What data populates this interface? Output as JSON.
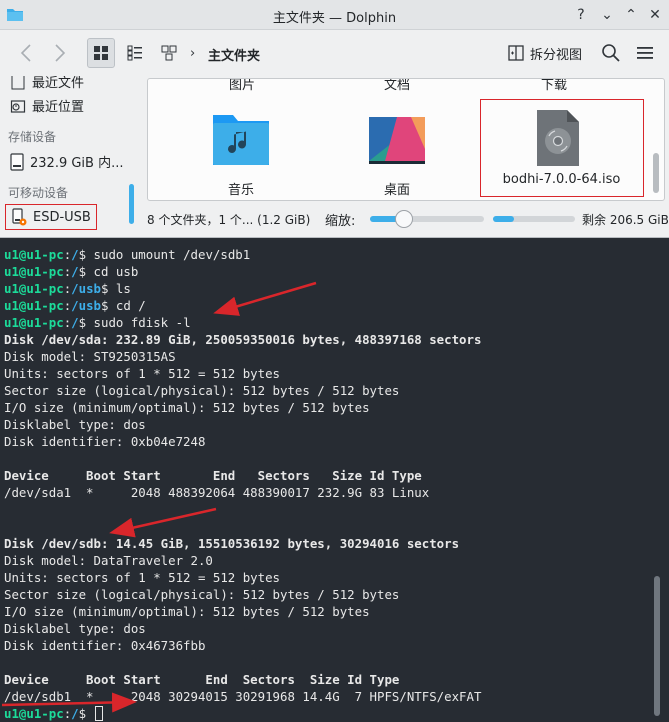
{
  "window": {
    "title": "主文件夹 — Dolphin"
  },
  "titlebar": {
    "help": "?",
    "minimize": "⌄",
    "maximize": "⌃",
    "close": "✕"
  },
  "toolbar": {
    "breadcrumb": "主文件夹",
    "split_view": "拆分视图"
  },
  "sidebar": {
    "cut_item": "最近文件",
    "recent_locations": "最近位置",
    "storage_header": "存储设备",
    "disk_label": "232.9 GiB 内...",
    "removable_header": "可移动设备",
    "usb_label": "ESD-USB"
  },
  "fileview": {
    "top_labels": [
      "图片",
      "文档",
      "下载"
    ],
    "items": [
      {
        "label": "音乐",
        "icon": "music-folder-icon"
      },
      {
        "label": "桌面",
        "icon": "desktop-folder-icon"
      },
      {
        "label": "bodhi-7.0.0-64.iso",
        "icon": "disc-image-icon"
      }
    ]
  },
  "statusbar": {
    "summary": "8 个文件夹，1 个... (1.2 GiB)",
    "zoom_label": "缩放:",
    "zoom_level": 0.3,
    "space_used": 0.25,
    "free": "剩余 206.5 GiB"
  },
  "terminal": {
    "user_host": "u1@u1-pc",
    "cmd1": {
      "dir": "/",
      "command": "sudo umount /dev/sdb1"
    },
    "cmd2": {
      "dir": "/",
      "command": "cd usb"
    },
    "cmd3": {
      "dir": "/usb",
      "command": "ls"
    },
    "cmd4": {
      "dir": "/usb",
      "command": "cd /"
    },
    "cmd5": {
      "dir": "/",
      "command": "sudo fdisk -l"
    },
    "sda": {
      "header": "Disk /dev/sda: 232.89 GiB, 250059350016 bytes, 488397168 sectors",
      "details": [
        "Disk model: ST9250315AS",
        "Units: sectors of 1 * 512 = 512 bytes",
        "Sector size (logical/physical): 512 bytes / 512 bytes",
        "I/O size (minimum/optimal): 512 bytes / 512 bytes",
        "Disklabel type: dos",
        "Disk identifier: 0xb04e7248"
      ],
      "table_header": "Device     Boot Start       End   Sectors   Size Id Type",
      "row": "/dev/sda1  *     2048 488392064 488390017 232.9G 83 Linux"
    },
    "sdb": {
      "header": "Disk /dev/sdb: 14.45 GiB, 15510536192 bytes, 30294016 sectors",
      "details": [
        "Disk model: DataTraveler 2.0",
        "Units: sectors of 1 * 512 = 512 bytes",
        "Sector size (logical/physical): 512 bytes / 512 bytes",
        "I/O size (minimum/optimal): 512 bytes / 512 bytes",
        "Disklabel type: dos",
        "Disk identifier: 0x46736fbb"
      ],
      "table_header": "Device     Boot Start      End  Sectors  Size Id Type",
      "row": "/dev/sdb1  *     2048 30294015 30291968 14.4G  7 HPFS/NTFS/exFAT"
    },
    "prompt_dir": "/"
  },
  "colors": {
    "accent": "#3daee9",
    "prompt_green": "#1cdc9a",
    "annotation_red": "#d9262b",
    "terminal_bg": "#272c33"
  }
}
